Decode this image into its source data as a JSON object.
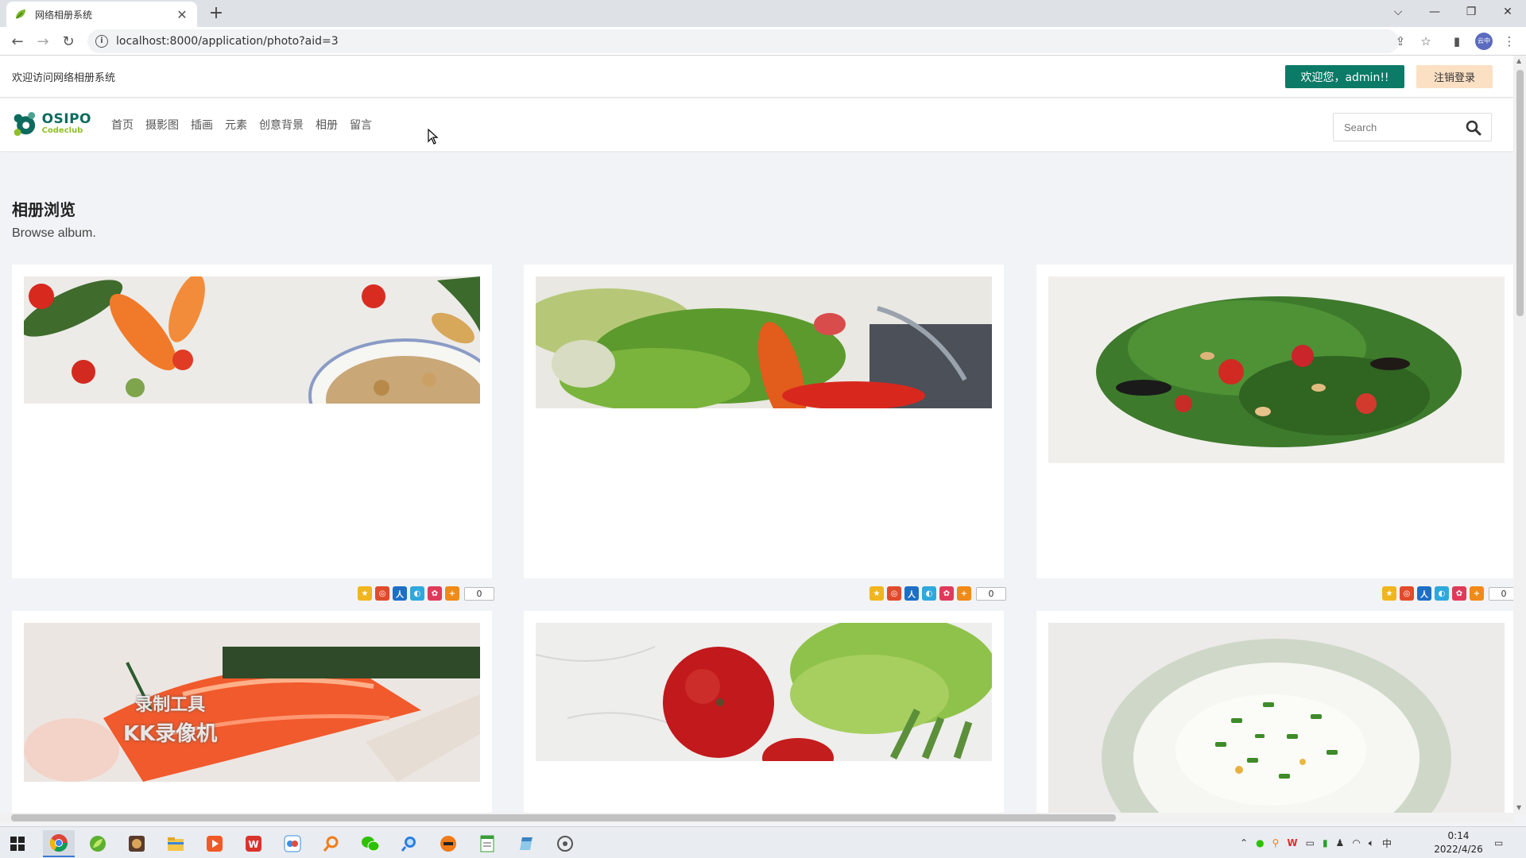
{
  "browser": {
    "tab_title": "网络相册系统",
    "url": "localhost:8000/application/photo?aid=3"
  },
  "topbar": {
    "welcome": "欢迎访问网络相册系统",
    "user_button": "欢迎您，admin!!",
    "logout_button": "注销登录"
  },
  "logo": {
    "main": "OSIPO",
    "sub": "Codeclub"
  },
  "nav": {
    "items": [
      {
        "label": "首页"
      },
      {
        "label": "摄影图"
      },
      {
        "label": "插画"
      },
      {
        "label": "元素"
      },
      {
        "label": "创意背景"
      },
      {
        "label": "相册"
      },
      {
        "label": "留言"
      }
    ]
  },
  "search": {
    "placeholder": "Search"
  },
  "page": {
    "title": "相册浏览",
    "subtitle": "Browse album."
  },
  "photos": [
    {
      "subject": "vegetables-and-grain-bowl",
      "share_count": "0"
    },
    {
      "subject": "green-salad-with-peppers",
      "share_count": "0"
    },
    {
      "subject": "arugula-salad-with-strawberries",
      "share_count": "0"
    },
    {
      "subject": "salmon-slices",
      "watermark_line1": "录制工具",
      "watermark_line2": "KK录像机"
    },
    {
      "subject": "tomato-and-lettuce"
    },
    {
      "subject": "rice-bowl-with-scallions"
    }
  ],
  "share_icons": [
    "qzone-icon",
    "weibo-icon",
    "renren-icon",
    "tqq-icon",
    "douban-icon",
    "more-share-icon"
  ],
  "colors": {
    "primary": "#0b7a67",
    "logout_bg": "#fbe0c4",
    "logo_green": "#0d6b5e",
    "logo_lime": "#8fbf2a"
  },
  "taskbar": {
    "clock_time": "0:14",
    "clock_date": "2022/4/26",
    "ime": "中"
  }
}
